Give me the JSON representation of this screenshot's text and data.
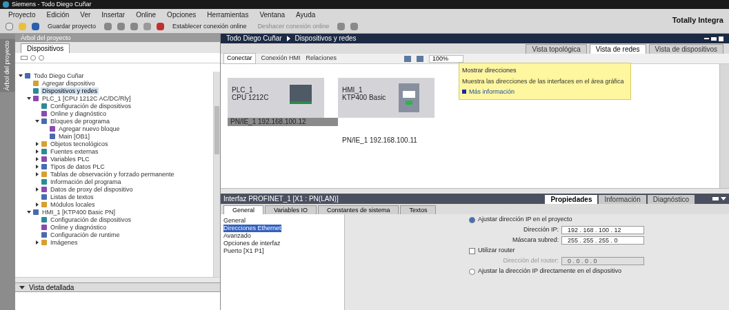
{
  "window": {
    "title": "Siemens - Todo Diego Cuñar"
  },
  "menu": [
    "Proyecto",
    "Edición",
    "Ver",
    "Insertar",
    "Online",
    "Opciones",
    "Herramientas",
    "Ventana",
    "Ayuda"
  ],
  "toolbar": {
    "save": "Guardar proyecto",
    "online": "Establecer conexión online",
    "offline": "Deshacer conexión online",
    "brand": "Totally Integra"
  },
  "project_tree": {
    "title": "Árbol del proyecto",
    "side_label": "Árbol del proyecto",
    "tab": "Dispositivos",
    "items": [
      {
        "label": "Todo Diego Cuñar",
        "expanded": true,
        "selected": false,
        "children": [
          {
            "label": "Agregar dispositivo",
            "selected": false
          },
          {
            "label": "Dispositivos y redes",
            "selected": true
          },
          {
            "label": "PLC_1 [CPU 1212C AC/DC/Rly]",
            "expanded": true,
            "selected": false,
            "children": [
              {
                "label": "Configuración de dispositivos",
                "selected": false
              },
              {
                "label": "Online y diagnóstico",
                "selected": false
              },
              {
                "label": "Bloques de programa",
                "expanded": true,
                "selected": false,
                "children": [
                  {
                    "label": "Agregar nuevo bloque",
                    "selected": false
                  },
                  {
                    "label": "Main [OB1]",
                    "selected": false
                  }
                ]
              },
              {
                "label": "Objetos tecnológicos",
                "expanded": false,
                "selected": false
              },
              {
                "label": "Fuentes externas",
                "expanded": false,
                "selected": false
              },
              {
                "label": "Variables PLC",
                "expanded": false,
                "selected": false
              },
              {
                "label": "Tipos de datos PLC",
                "expanded": false,
                "selected": false
              },
              {
                "label": "Tablas de observación y forzado permanente",
                "expanded": false,
                "selected": false
              },
              {
                "label": "Información del programa",
                "selected": false
              },
              {
                "label": "Datos de proxy del dispositivo",
                "expanded": false,
                "selected": false
              },
              {
                "label": "Listas de textos",
                "selected": false
              },
              {
                "label": "Módulos locales",
                "expanded": false,
                "selected": false
              }
            ]
          },
          {
            "label": "HMI_1 [KTP400 Basic PN]",
            "expanded": true,
            "selected": false,
            "children": [
              {
                "label": "Configuración de dispositivos",
                "selected": false
              },
              {
                "label": "Online y diagnóstico",
                "selected": false
              },
              {
                "label": "Configuración de runtime",
                "selected": false
              },
              {
                "label": "Imágenes",
                "expanded": false,
                "selected": false
              }
            ]
          }
        ]
      }
    ]
  },
  "details_view": {
    "title": "Vista detallada"
  },
  "editor": {
    "breadcrumb": [
      "Todo Diego Cuñar",
      "Dispositivos y redes"
    ],
    "views": [
      {
        "label": "Vista topológica",
        "selected": false
      },
      {
        "label": "Vista de redes",
        "selected": true
      },
      {
        "label": "Vista de dispositivos",
        "selected": false
      }
    ],
    "tools": {
      "connect": "Conectar",
      "hmi": "Conexión HMI",
      "relations": "Relaciones",
      "zoom": "100%"
    },
    "tooltip": {
      "title": "Mostrar direcciones",
      "text": "Muestra las direcciones de las interfaces en el área gráfica",
      "link": "Más información"
    },
    "devices": [
      {
        "kind": "plc",
        "name": "PLC_1",
        "model": "CPU 1212C",
        "network": "PN/IE_1  192.168.100.12"
      },
      {
        "kind": "hmi",
        "name": "HMI_1",
        "model": "KTP400 Basic",
        "network": "PN/IE_1  192.168.100.11"
      }
    ]
  },
  "inspector": {
    "title": "Interfaz PROFINET_1 [X1 : PN(LAN)]",
    "tabs": [
      {
        "label": "Propiedades",
        "selected": true
      },
      {
        "label": "Información",
        "selected": false
      },
      {
        "label": "Diagnóstico",
        "selected": false
      }
    ],
    "subtabs": [
      {
        "label": "General",
        "selected": true
      },
      {
        "label": "Variables IO",
        "selected": false
      },
      {
        "label": "Constantes de sistema",
        "selected": false
      },
      {
        "label": "Textos",
        "selected": false
      }
    ],
    "nav": [
      {
        "label": "General",
        "selected": false
      },
      {
        "label": "Direcciones Ethernet",
        "selected": true
      },
      {
        "label": "Avanzado",
        "selected": false
      },
      {
        "label": "Opciones de interfaz",
        "selected": false
      },
      {
        "label": "Puerto [X1 P1]",
        "selected": false
      }
    ],
    "form": [
      {
        "kind": "radio",
        "label": "Ajustar dirección IP en el proyecto",
        "selected": true
      },
      {
        "kind": "field",
        "label": "Dirección IP:",
        "value": "192 . 168 . 100 . 12"
      },
      {
        "kind": "field",
        "label": "Máscara subred:",
        "value": "255 . 255 . 255 . 0"
      },
      {
        "kind": "checkbox",
        "label": "Utilizar router",
        "checked": false
      },
      {
        "kind": "field",
        "label": "Dirección del router:",
        "value": "0 . 0 . 0 . 0",
        "disabled": true
      },
      {
        "kind": "radio",
        "label": "Ajustar la dirección IP directamente en el dispositivo",
        "selected": false
      }
    ]
  }
}
